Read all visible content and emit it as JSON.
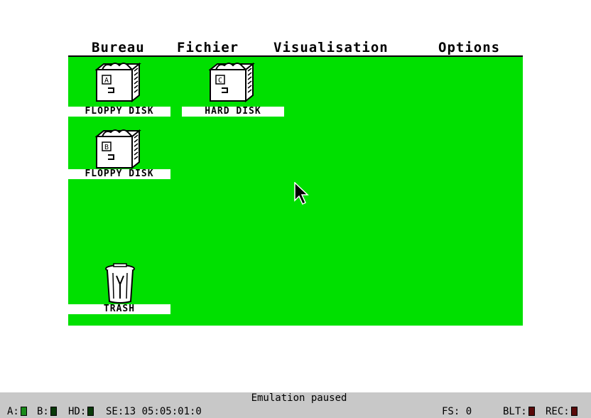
{
  "menu": {
    "bureau": "Bureau",
    "fichier": "Fichier",
    "visualisation": "Visualisation",
    "options": "Options"
  },
  "desktop": {
    "background_color": "#00e000",
    "icons": [
      {
        "label": "FLOPPY DISK",
        "drive_letter": "A",
        "icon": "floppy-drawer-icon"
      },
      {
        "label": "HARD DISK",
        "drive_letter": "C",
        "icon": "hard-disk-drawer-icon"
      },
      {
        "label": "FLOPPY DISK",
        "drive_letter": "B",
        "icon": "floppy-drawer-icon"
      },
      {
        "label": "TRASH",
        "icon": "trash-can-icon"
      }
    ]
  },
  "status": {
    "message": "Emulation paused",
    "a_label": "A:",
    "b_label": "B:",
    "hd_label": "HD:",
    "se_time": "SE:13 05:05:01:0",
    "fs_label": "FS: 0",
    "blt_label": "BLT:",
    "rec_label": "REC:",
    "led_green": "#1a8a1a",
    "led_dark_green": "#0a3a0a",
    "led_dark_red": "#5a0a0a"
  }
}
